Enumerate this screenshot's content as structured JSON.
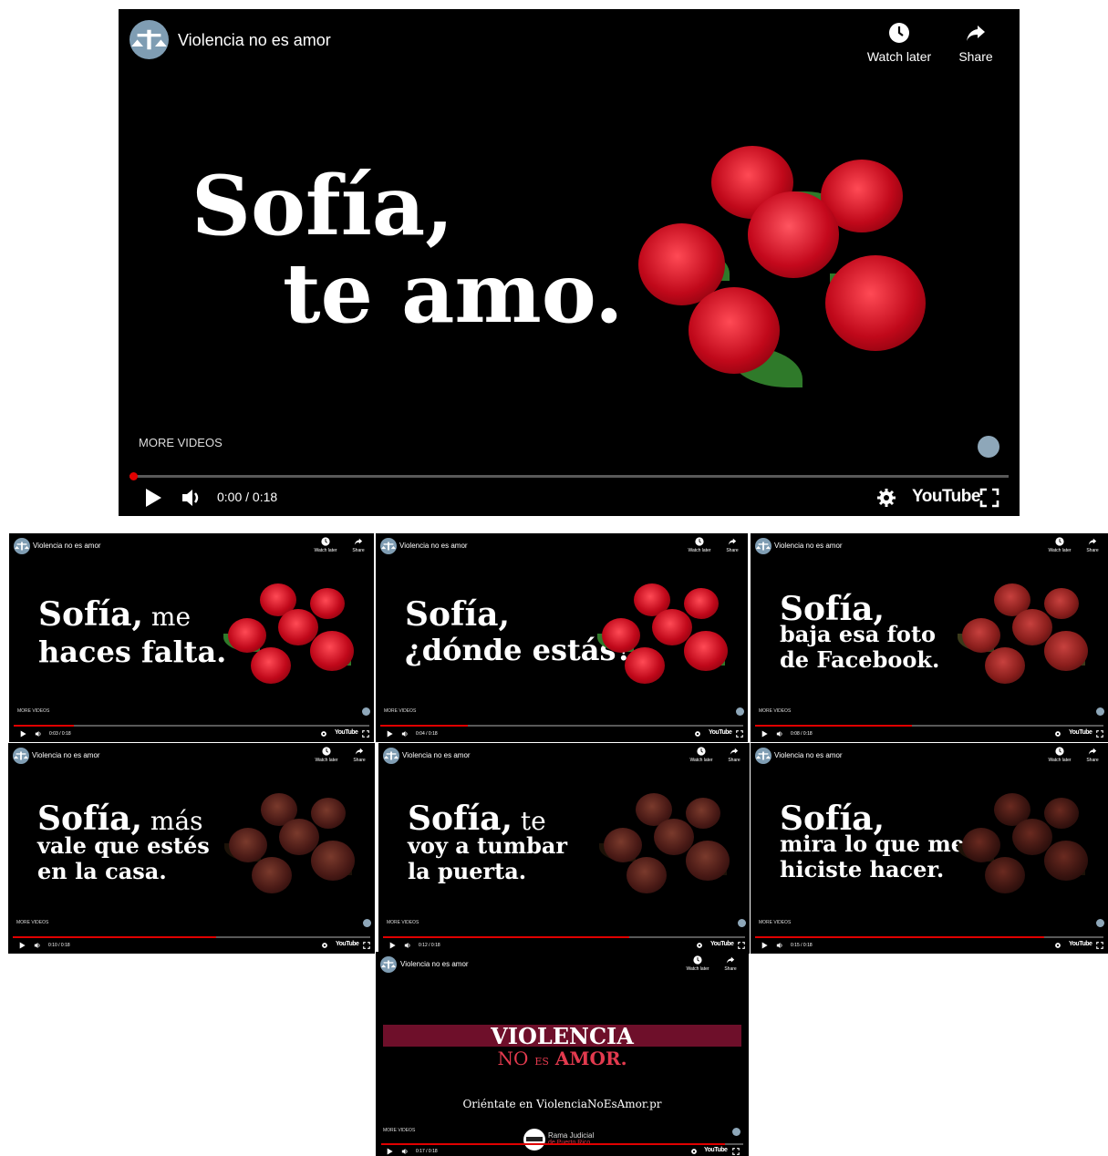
{
  "channel": {
    "title": "Violencia no es amor",
    "watch_later": "Watch later",
    "share": "Share",
    "more_videos": "MORE VIDEOS",
    "youtube": "YouTube"
  },
  "main_player": {
    "line1": "Sofía,",
    "line2": "te amo.",
    "time": "0:00 / 0:18",
    "progress": 0.0
  },
  "thumbnails": [
    {
      "lines": [
        [
          "Sofía,",
          " me"
        ],
        [
          "haces falta.",
          ""
        ]
      ],
      "time": "0:03 / 0:18",
      "progress": 0.17,
      "roses": "fresh"
    },
    {
      "lines": [
        [
          "Sofía,",
          ""
        ],
        [
          "¿dónde estás?",
          ""
        ]
      ],
      "time": "0:04 / 0:18",
      "progress": 0.24,
      "roses": "fresh"
    },
    {
      "lines": [
        [
          "Sofía,",
          ""
        ],
        [
          "baja esa foto",
          ""
        ],
        [
          "de Facebook.",
          ""
        ]
      ],
      "time": "0:08 / 0:18",
      "progress": 0.45,
      "roses": "wilting"
    },
    {
      "lines": [
        [
          "Sofía,",
          " más"
        ],
        [
          "vale que estés",
          ""
        ],
        [
          "en la casa.",
          ""
        ]
      ],
      "time": "0:10 / 0:18",
      "progress": 0.57,
      "roses": "dead"
    },
    {
      "lines": [
        [
          "Sofía,",
          " te"
        ],
        [
          "voy a tumbar",
          ""
        ],
        [
          "la puerta.",
          ""
        ]
      ],
      "time": "0:12 / 0:18",
      "progress": 0.68,
      "roses": "dead"
    },
    {
      "lines": [
        [
          "Sofía,",
          ""
        ],
        [
          "mira lo que me",
          ""
        ],
        [
          "hiciste hacer.",
          ""
        ]
      ],
      "time": "0:15 / 0:18",
      "progress": 0.83,
      "roses": "burnt"
    }
  ],
  "final": {
    "title_big": "VIOLENCIA",
    "sub_no": "NO",
    "sub_es": "ES",
    "sub_amor": "AMOR.",
    "site": "Oriéntate en ViolenciaNoEsAmor.pr",
    "rama_1": "Rama Judicial",
    "rama_2": "de Puerto Rico",
    "time": "0:17 / 0:18",
    "progress": 0.95
  },
  "colors": {
    "progress": "#e00000",
    "banner": "#6e0f2a",
    "amor_red": "#e23a4e",
    "rose_fresh": "#d4101c",
    "rose_dead": "#4a1a16"
  },
  "icons": [
    "scales-logo-icon",
    "clock-icon",
    "share-arrow-icon",
    "play-icon",
    "volume-icon",
    "gear-icon",
    "fullscreen-icon"
  ]
}
